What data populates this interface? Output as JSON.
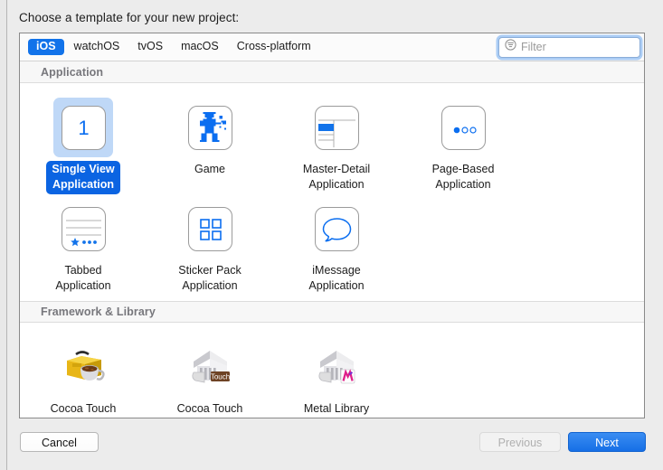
{
  "window": {
    "prompt": "Choose a template for your new project:"
  },
  "colors": {
    "accent_blue": "#1273ea",
    "selected_label_blue": "#0b64e2",
    "selection_halo": "#bfd8f7",
    "section_header_text": "#77777c",
    "icon_blue": "#0b6ef0",
    "toolbox_yellow": "#e8b617",
    "metal_pink": "#e0218a"
  },
  "tabs": [
    {
      "label": "iOS",
      "selected": true
    },
    {
      "label": "watchOS",
      "selected": false
    },
    {
      "label": "tvOS",
      "selected": false
    },
    {
      "label": "macOS",
      "selected": false
    },
    {
      "label": "Cross-platform",
      "selected": false
    }
  ],
  "filter": {
    "icon": "filter-circle-icon",
    "placeholder": "Filter",
    "value": ""
  },
  "sections": [
    {
      "title": "Application",
      "items": [
        {
          "label": "Single View\nApplication",
          "icon": "single-view-icon",
          "selected": true
        },
        {
          "label": "Game",
          "icon": "game-robot-icon",
          "selected": false
        },
        {
          "label": "Master-Detail\nApplication",
          "icon": "master-detail-icon",
          "selected": false
        },
        {
          "label": "Page-Based\nApplication",
          "icon": "page-based-icon",
          "selected": false
        },
        {
          "label": "Tabbed\nApplication",
          "icon": "tabbed-icon",
          "selected": false
        },
        {
          "label": "Sticker Pack\nApplication",
          "icon": "sticker-pack-icon",
          "selected": false
        },
        {
          "label": "iMessage\nApplication",
          "icon": "imessage-bubble-icon",
          "selected": false
        }
      ]
    },
    {
      "title": "Framework & Library",
      "items": [
        {
          "label": "Cocoa Touch\nFramework",
          "icon": "toolbox-coffee-icon",
          "selected": false
        },
        {
          "label": "Cocoa Touch\nStatic Library",
          "icon": "library-temple-touch-icon",
          "selected": false
        },
        {
          "label": "Metal Library",
          "icon": "library-temple-metal-icon",
          "selected": false
        }
      ]
    }
  ],
  "footer": {
    "cancel_label": "Cancel",
    "previous_label": "Previous",
    "next_label": "Next"
  }
}
